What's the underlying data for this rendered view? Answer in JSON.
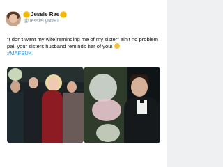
{
  "user": {
    "display_name": "Jessie Rae",
    "handle": "@JessieLynn90",
    "avatar_icon": "profile-photo",
    "name_emoji_icon": "sunflower-emoji-icon"
  },
  "tweet": {
    "text": "“I don’t want my wife reminding me of my sister” ain’t no problem pal, your sisters husband reminds her of you!",
    "emoji_icon": "grimace-emoji-icon",
    "hashtag": "#MAFSUK"
  },
  "media": [
    {
      "name": "left-photo"
    },
    {
      "name": "right-photo"
    }
  ],
  "colors": {
    "accent": "#1d9bf0",
    "text": "#111111",
    "muted": "#7b8a97"
  }
}
